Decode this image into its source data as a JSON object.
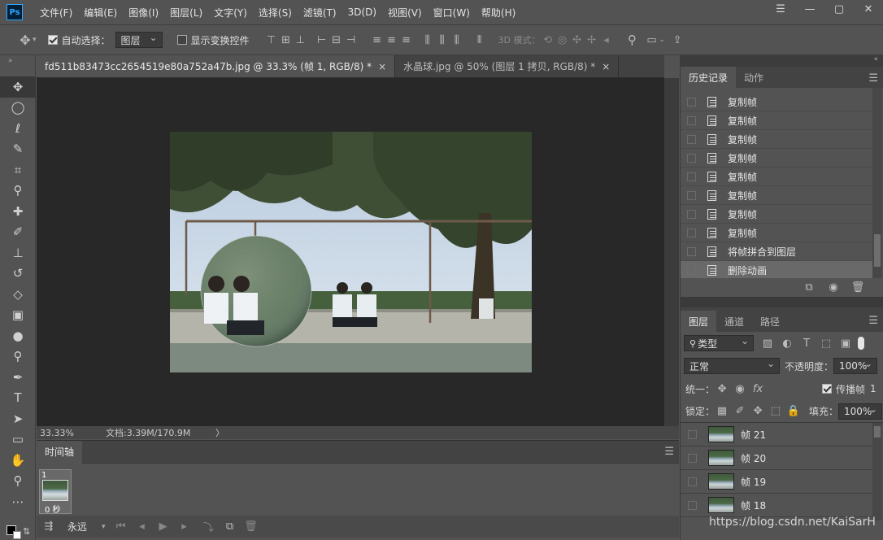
{
  "app": {
    "logo": "Ps"
  },
  "menu": [
    "文件(F)",
    "编辑(E)",
    "图像(I)",
    "图层(L)",
    "文字(Y)",
    "选择(S)",
    "滤镜(T)",
    "3D(D)",
    "视图(V)",
    "窗口(W)",
    "帮助(H)"
  ],
  "window_controls": {
    "menu_icon": "☰",
    "minimize": "—",
    "maximize": "▢",
    "close": "✕"
  },
  "options": {
    "auto_select_label": "自动选择：",
    "auto_select_value": "图层",
    "show_transform_label": "显示变换控件",
    "mode_3d_label": "3D 模式："
  },
  "tabs": [
    {
      "label": "fd511b83473cc2654519e80a752a47b.jpg @ 33.3% (帧 1, RGB/8) *",
      "active": true
    },
    {
      "label": "水晶球.jpg @ 50% (图层 1 拷贝, RGB/8) *",
      "active": false
    }
  ],
  "tab_close": "×",
  "status": {
    "zoom": "33.33%",
    "doc": "文档:3.39M/170.9M",
    "arrow": "〉"
  },
  "timeline": {
    "title": "时间轴",
    "frame_number": "1",
    "frame_delay": "0 秒",
    "loop": "永远"
  },
  "history_panel": {
    "tabs": [
      "历史记录",
      "动作"
    ],
    "items": [
      {
        "label": "复制帧",
        "selected": false
      },
      {
        "label": "复制帧",
        "selected": false
      },
      {
        "label": "复制帧",
        "selected": false
      },
      {
        "label": "复制帧",
        "selected": false
      },
      {
        "label": "复制帧",
        "selected": false
      },
      {
        "label": "复制帧",
        "selected": false
      },
      {
        "label": "复制帧",
        "selected": false
      },
      {
        "label": "复制帧",
        "selected": false
      },
      {
        "label": "将帧拼合到图层",
        "selected": false
      },
      {
        "label": "删除动画",
        "selected": true
      }
    ]
  },
  "layers_panel": {
    "tabs": [
      "图层",
      "通道",
      "路径"
    ],
    "filter_label": "类型",
    "blend_mode": "正常",
    "opacity_label": "不透明度：",
    "opacity_value": "100%",
    "unify_label": "统一：",
    "propagate_label": "传播帧",
    "propagate_value": "1",
    "lock_label": "锁定：",
    "fill_label": "填充：",
    "fill_value": "100%",
    "layers": [
      "帧 21",
      "帧 20",
      "帧 19",
      "帧 18"
    ]
  },
  "watermark": "https://blog.csdn.net/KaiSarH",
  "colors": {
    "ui_bg": "#535353",
    "canvas_bg": "#282828",
    "accent": "#31a8ff"
  }
}
